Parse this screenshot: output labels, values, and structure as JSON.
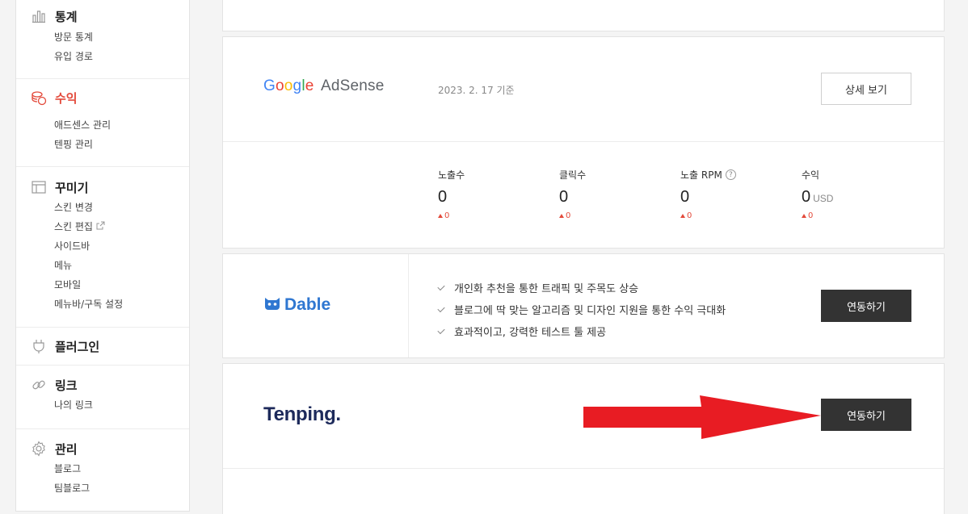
{
  "sidebar": {
    "sections": [
      {
        "title": "통계",
        "icon": "bar-chart-icon",
        "items": [
          "방문 통계",
          "유입 경로"
        ]
      },
      {
        "title": "수익",
        "icon": "coins-icon",
        "items": [
          "애드센스 관리",
          "텐핑 관리"
        ]
      },
      {
        "title": "꾸미기",
        "icon": "layout-icon",
        "items": [
          "스킨 변경",
          "스킨 편집",
          "사이드바",
          "메뉴",
          "모바일",
          "메뉴바/구독 설정"
        ]
      },
      {
        "title": "플러그인",
        "icon": "plug-icon",
        "items": []
      },
      {
        "title": "링크",
        "icon": "link-icon",
        "items": [
          "나의 링크"
        ]
      },
      {
        "title": "관리",
        "icon": "gear-icon",
        "items": [
          "블로그",
          "팀블로그"
        ]
      }
    ]
  },
  "adsense": {
    "logo_google": [
      "G",
      "o",
      "o",
      "g",
      "l",
      "e"
    ],
    "logo_adsense": "AdSense",
    "date": "2023. 2. 17 기준",
    "detail_button": "상세 보기",
    "stats": [
      {
        "label": "노출수",
        "value": "0",
        "unit": "",
        "delta": "0"
      },
      {
        "label": "클릭수",
        "value": "0",
        "unit": "",
        "delta": "0"
      },
      {
        "label": "노출 RPM",
        "value": "0",
        "unit": "",
        "delta": "0",
        "help": "?"
      },
      {
        "label": "수익",
        "value": "0",
        "unit": "USD",
        "delta": "0"
      }
    ]
  },
  "dable": {
    "logo": "Dable",
    "features": [
      "개인화 추천을 통한 트래픽 및 주목도 상승",
      "블로그에 딱 맞는 알고리즘 및 디자인 지원을 통한 수익 극대화",
      "효과적이고, 강력한 테스트 툴 제공"
    ],
    "button": "연동하기"
  },
  "tenping": {
    "logo": "Tenping.",
    "button": "연동하기"
  },
  "colors": {
    "accent_red": "#e34a3b",
    "dark_button": "#333333",
    "arrow_red": "#e81c23",
    "dable_blue": "#2f77d1",
    "tenping_navy": "#1d2a5b"
  }
}
